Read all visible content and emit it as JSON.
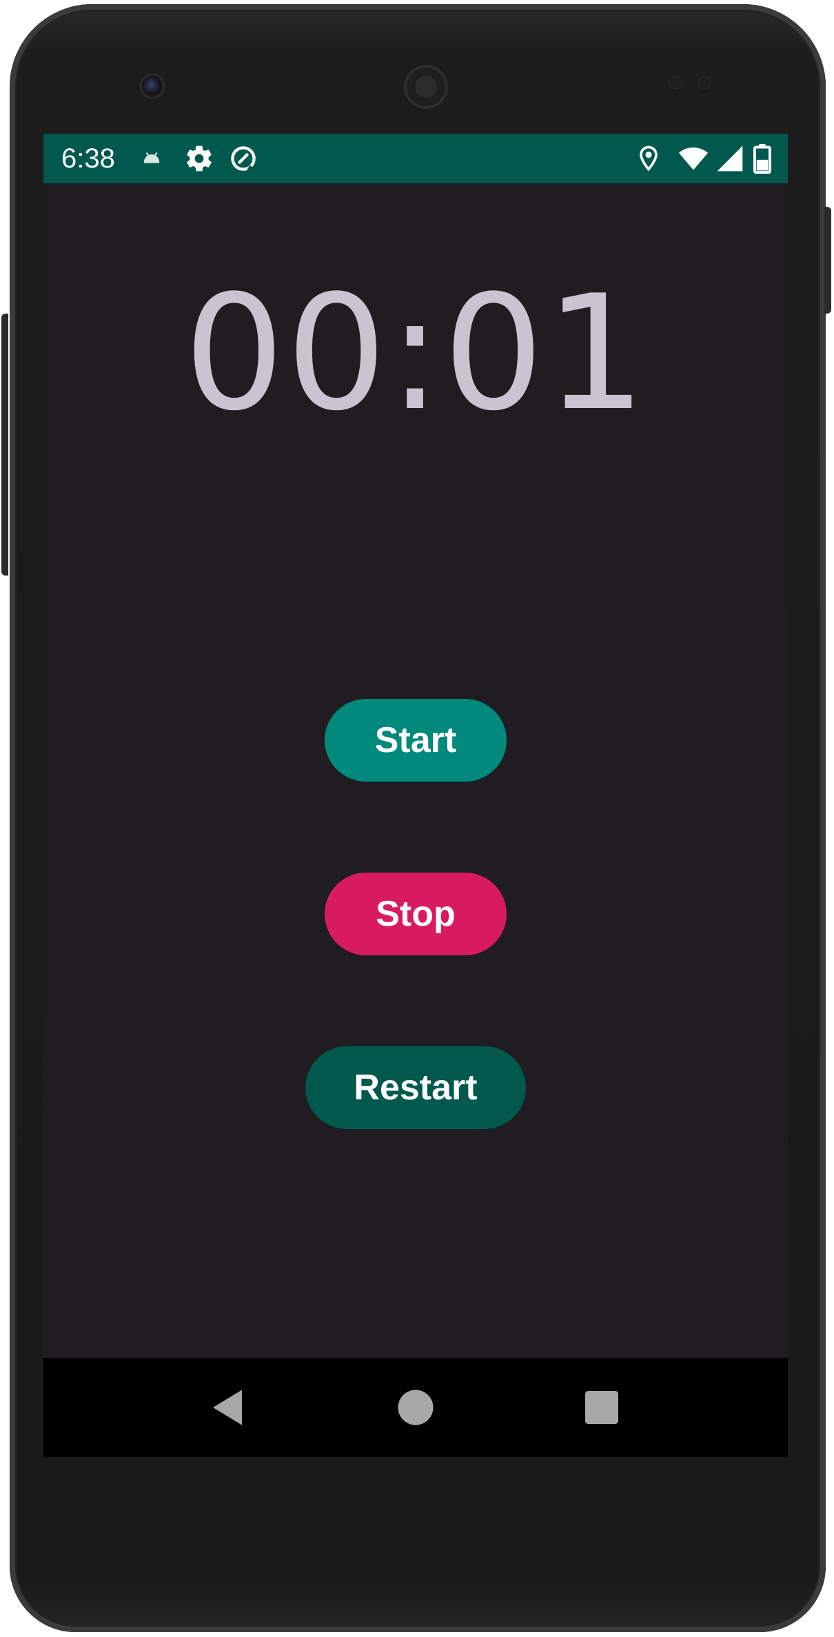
{
  "status_bar": {
    "time": "6:38",
    "background_color": "#01594d",
    "left_icons": [
      "android-notification-icon",
      "settings-gear-icon",
      "data-saver-icon"
    ],
    "right_icons": [
      "location-icon",
      "wifi-icon",
      "cell-signal-icon",
      "battery-icon"
    ]
  },
  "stopwatch": {
    "display": "00:01",
    "text_color": "#cac3d0"
  },
  "buttons": {
    "start": {
      "label": "Start",
      "color": "#01897b"
    },
    "stop": {
      "label": "Stop",
      "color": "#d81b60"
    },
    "restart": {
      "label": "Restart",
      "color": "#01594d"
    }
  },
  "navigation_bar": {
    "items": [
      "back-icon",
      "home-icon",
      "recents-icon"
    ]
  },
  "screen_background": "#1f1d22"
}
